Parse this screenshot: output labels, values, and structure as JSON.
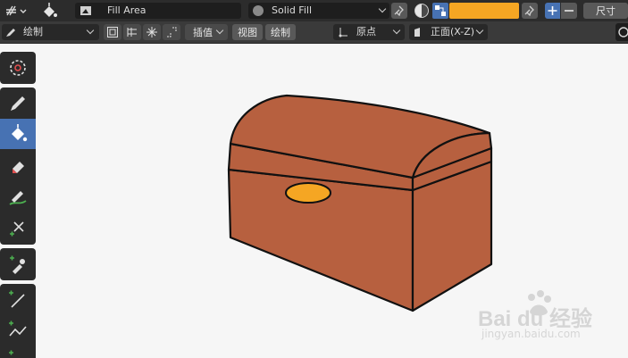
{
  "top_header": {
    "fill_name": "Fill Area",
    "material_name": "Solid Fill",
    "material_color": "#f5a623",
    "size_label": "尺寸"
  },
  "tool_header": {
    "mode": "绘制",
    "interpolate": "插值",
    "view_menu": "视图",
    "draw_menu": "绘制",
    "origin": "原点",
    "orientation": "正面(X-Z)"
  },
  "tools": [
    {
      "name": "cursor-tool",
      "icon": "cursor-icon"
    },
    {
      "name": "draw-tool",
      "icon": "pencil-icon"
    },
    {
      "name": "fill-tool",
      "icon": "fill-bucket-icon",
      "active": true
    },
    {
      "name": "erase-tool",
      "icon": "eraser-icon"
    },
    {
      "name": "tint-tool",
      "icon": "tint-icon"
    },
    {
      "name": "cutter-tool",
      "icon": "scissors-icon"
    },
    {
      "name": "eyedropper-tool",
      "icon": "eyedropper-icon"
    },
    {
      "name": "line-tool",
      "icon": "line-icon"
    },
    {
      "name": "polyline-tool",
      "icon": "polyline-icon"
    }
  ],
  "drawing": {
    "subject": "treasure chest",
    "body_color": "#b7603f",
    "lock_color": "#f5a623",
    "outline_color": "#111111"
  },
  "watermark": {
    "brand": "Bai du 经验",
    "url": "jingyan.baidu.com"
  }
}
